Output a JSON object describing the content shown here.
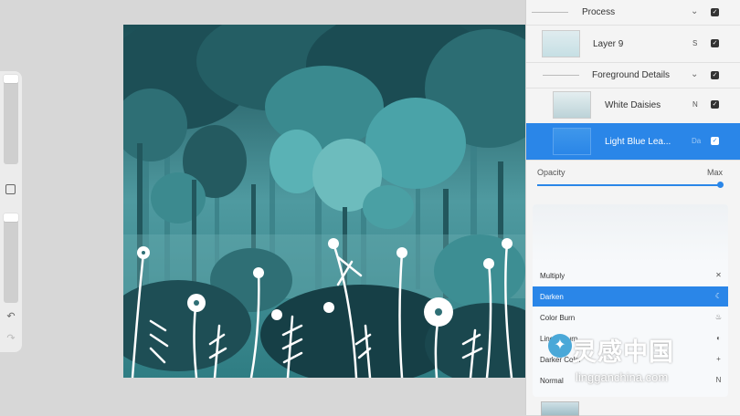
{
  "layers": {
    "groups": [
      {
        "name": "Process"
      },
      {
        "name": "Foreground Details"
      }
    ],
    "items": [
      {
        "name": "Layer 9",
        "blend": "S"
      },
      {
        "name": "White Daisies",
        "blend": "N"
      },
      {
        "name": "Light Blue Lea...",
        "blend": "Da"
      }
    ],
    "opacity": {
      "label": "Opacity",
      "value_label": "Max",
      "value": 1.0
    }
  },
  "blend_modes": [
    {
      "label": "Multiply",
      "icon": "multiply-icon"
    },
    {
      "label": "Darken",
      "icon": "moon-icon",
      "selected": true
    },
    {
      "label": "Color Burn",
      "icon": "flame-icon"
    },
    {
      "label": "Linear Burn",
      "icon": "linear-burn-icon"
    },
    {
      "label": "Darker Color",
      "icon": "plus-icon"
    },
    {
      "label": "Normal",
      "icon": "normal-icon"
    }
  ],
  "watermark": {
    "title": "灵感中国",
    "url": "lingganchina.com"
  },
  "colors": {
    "accent": "#2a86e8",
    "canvas_dark": "#1f5c62",
    "foliage": "#4aa3a8"
  }
}
